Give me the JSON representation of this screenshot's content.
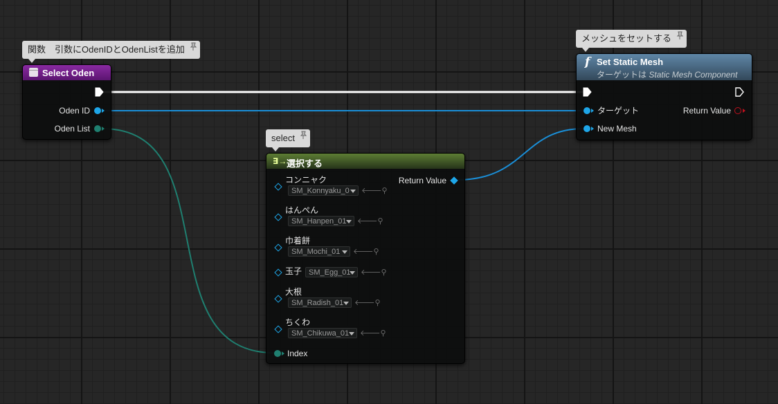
{
  "comments": {
    "select_oden": "関数　引数にOdenIDとOdenListを追加",
    "set_mesh": "メッシュをセットする",
    "select": "select"
  },
  "select_oden_node": {
    "title": "Select Oden",
    "pins": {
      "oden_id": "Oden ID",
      "oden_list": "Oden List"
    }
  },
  "set_static_mesh_node": {
    "icon_glyph": "f",
    "title": "Set Static Mesh",
    "subtitle_prefix": "ターゲットは",
    "subtitle_class": "Static Mesh Component",
    "pins": {
      "target": "ターゲット",
      "new_mesh": "New Mesh",
      "return_value": "Return Value"
    }
  },
  "select_node": {
    "icon_glyph": "∃→",
    "title": "選択する",
    "return_value": "Return Value",
    "index_label": "Index",
    "options": [
      {
        "label": "コンニャク",
        "value": "SM_Konnyaku_0"
      },
      {
        "label": "はんぺん",
        "value": "SM_Hanpen_01"
      },
      {
        "label": "巾着餅",
        "value": "SM_Mochi_01"
      },
      {
        "label": "玉子",
        "value": "SM_Egg_01"
      },
      {
        "label": "大根",
        "value": "SM_Radish_01"
      },
      {
        "label": "ちくわ",
        "value": "SM_Chikuwa_01"
      }
    ]
  },
  "colors": {
    "exec_wire": "#ffffff",
    "object_wire": "#1a8fd8",
    "integer_wire": "#1f7f70",
    "function_header": "#6e1b84",
    "call_header": "#4b6d8a",
    "select_header": "#4d6a2a",
    "background": "#262626"
  },
  "icons": {
    "function_entry": "function-entry-icon",
    "function_call": "function-f-icon",
    "select": "select-icon",
    "exec": "exec-pin-icon",
    "use_selected": "arrow-left-icon",
    "browse": "magnifier-icon"
  }
}
